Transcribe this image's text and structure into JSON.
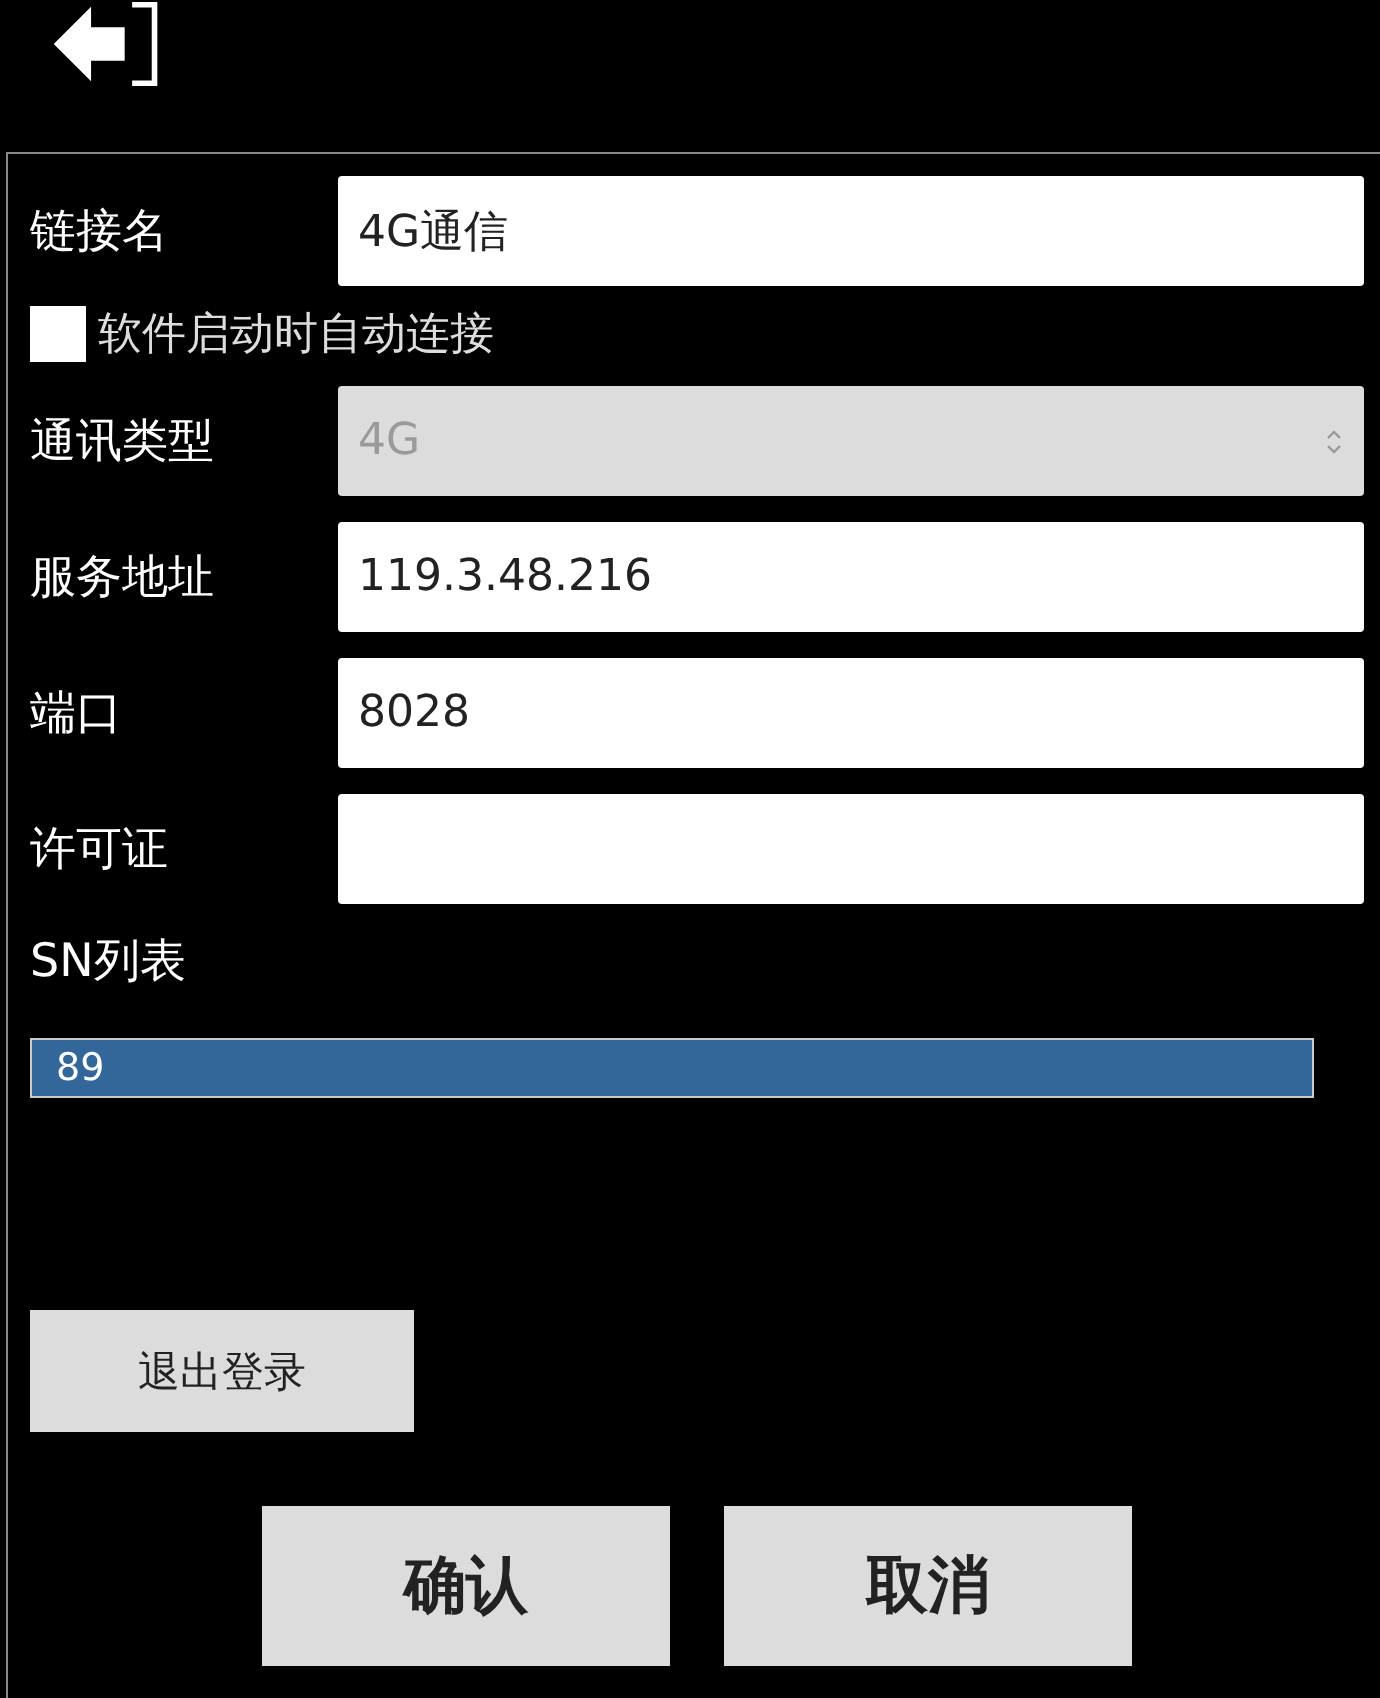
{
  "fields": [
    {
      "kind": "text",
      "label": "链接名",
      "value": "4G通信"
    },
    {
      "kind": "checkbox",
      "label": "软件启动时自动连接",
      "checked": false
    },
    {
      "kind": "select",
      "label": "通讯类型",
      "value": "4G",
      "disabled": true
    },
    {
      "kind": "text",
      "label": "服务地址",
      "value": "119.3.48.216"
    },
    {
      "kind": "text",
      "label": "端口",
      "value": "8028"
    },
    {
      "kind": "text",
      "label": "许可证"
    }
  ],
  "sn_list": {
    "label": "SN列表",
    "items": [
      {
        "text": "89",
        "selected": true
      }
    ]
  },
  "logout_button": "退出登录",
  "buttons": [
    "确认",
    "取消"
  ]
}
